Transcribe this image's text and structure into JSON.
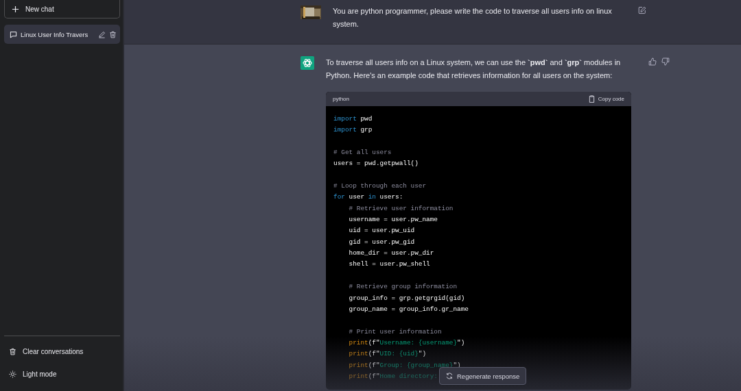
{
  "sidebar": {
    "new_chat": {
      "label": "New chat"
    },
    "conversations": [
      {
        "label": "Linux User Info Travers",
        "selected": true
      }
    ],
    "footer": [
      {
        "kind": "clear",
        "label": "Clear conversations"
      },
      {
        "kind": "theme",
        "label": "Light mode"
      }
    ]
  },
  "prompt": {
    "text": "You are python programmer, please write the code to traverse all users info on linux system."
  },
  "answer": {
    "text": "To traverse all users info on a Linux system, we can use the **`pwd`** and **`grp`** modules in Python. Here's an example code that retrieves information for all users on the system:",
    "code": {
      "language": "python",
      "copy_label": "Copy code",
      "lines": [
        {
          "kind": "code",
          "tokens": [
            {
              "kind": "keyword",
              "text": "import"
            },
            {
              "kind": "plain",
              "text": " pwd"
            }
          ]
        },
        {
          "kind": "code",
          "tokens": [
            {
              "kind": "keyword",
              "text": "import"
            },
            {
              "kind": "plain",
              "text": " grp"
            }
          ]
        },
        {
          "kind": "blank"
        },
        {
          "kind": "code",
          "tokens": [
            {
              "kind": "comment",
              "text": "# Get all users"
            }
          ]
        },
        {
          "kind": "code",
          "tokens": [
            {
              "kind": "plain",
              "text": "users = pwd.getpwall()"
            }
          ]
        },
        {
          "kind": "blank"
        },
        {
          "kind": "code",
          "tokens": [
            {
              "kind": "comment",
              "text": "# Loop through each user"
            }
          ]
        },
        {
          "kind": "code",
          "tokens": [
            {
              "kind": "keyword",
              "text": "for"
            },
            {
              "kind": "plain",
              "text": " user "
            },
            {
              "kind": "keyword",
              "text": "in"
            },
            {
              "kind": "plain",
              "text": " users:"
            }
          ]
        },
        {
          "kind": "code",
          "tokens": [
            {
              "kind": "comment",
              "text": "    # Retrieve user information"
            }
          ]
        },
        {
          "kind": "code",
          "tokens": [
            {
              "kind": "plain",
              "text": "    username = user.pw_name"
            }
          ]
        },
        {
          "kind": "code",
          "tokens": [
            {
              "kind": "plain",
              "text": "    uid = user.pw_uid"
            }
          ]
        },
        {
          "kind": "code",
          "tokens": [
            {
              "kind": "plain",
              "text": "    gid = user.pw_gid"
            }
          ]
        },
        {
          "kind": "code",
          "tokens": [
            {
              "kind": "plain",
              "text": "    home_dir = user.pw_dir"
            }
          ]
        },
        {
          "kind": "code",
          "tokens": [
            {
              "kind": "plain",
              "text": "    shell = user.pw_shell"
            }
          ]
        },
        {
          "kind": "blank"
        },
        {
          "kind": "code",
          "tokens": [
            {
              "kind": "comment",
              "text": "    # Retrieve group information"
            }
          ]
        },
        {
          "kind": "code",
          "tokens": [
            {
              "kind": "plain",
              "text": "    group_info = grp.getgrgid(gid)"
            }
          ]
        },
        {
          "kind": "code",
          "tokens": [
            {
              "kind": "plain",
              "text": "    group_name = group_info.gr_name"
            }
          ]
        },
        {
          "kind": "blank"
        },
        {
          "kind": "code",
          "tokens": [
            {
              "kind": "comment",
              "text": "    # Print user information"
            }
          ]
        },
        {
          "kind": "code",
          "tokens": [
            {
              "kind": "builtin",
              "text": "    print"
            },
            {
              "kind": "plain",
              "text": "(f\""
            },
            {
              "kind": "string",
              "text": "Username: {username}"
            },
            {
              "kind": "plain",
              "text": "\")"
            }
          ]
        },
        {
          "kind": "code",
          "tokens": [
            {
              "kind": "builtin",
              "text": "    print"
            },
            {
              "kind": "plain",
              "text": "(f\""
            },
            {
              "kind": "string",
              "text": "UID: {uid}"
            },
            {
              "kind": "plain",
              "text": "\")"
            }
          ]
        },
        {
          "kind": "code",
          "tokens": [
            {
              "kind": "builtin",
              "text": "    print"
            },
            {
              "kind": "plain",
              "text": "(f\""
            },
            {
              "kind": "string",
              "text": "Group: {group_name}"
            },
            {
              "kind": "plain",
              "text": "\")"
            }
          ]
        },
        {
          "kind": "code",
          "tokens": [
            {
              "kind": "builtin",
              "text": "    print"
            },
            {
              "kind": "plain",
              "text": "(f\""
            },
            {
              "kind": "string",
              "text": "Home directory:"
            }
          ]
        }
      ]
    }
  },
  "regenerate": {
    "label": "Regenerate response"
  }
}
